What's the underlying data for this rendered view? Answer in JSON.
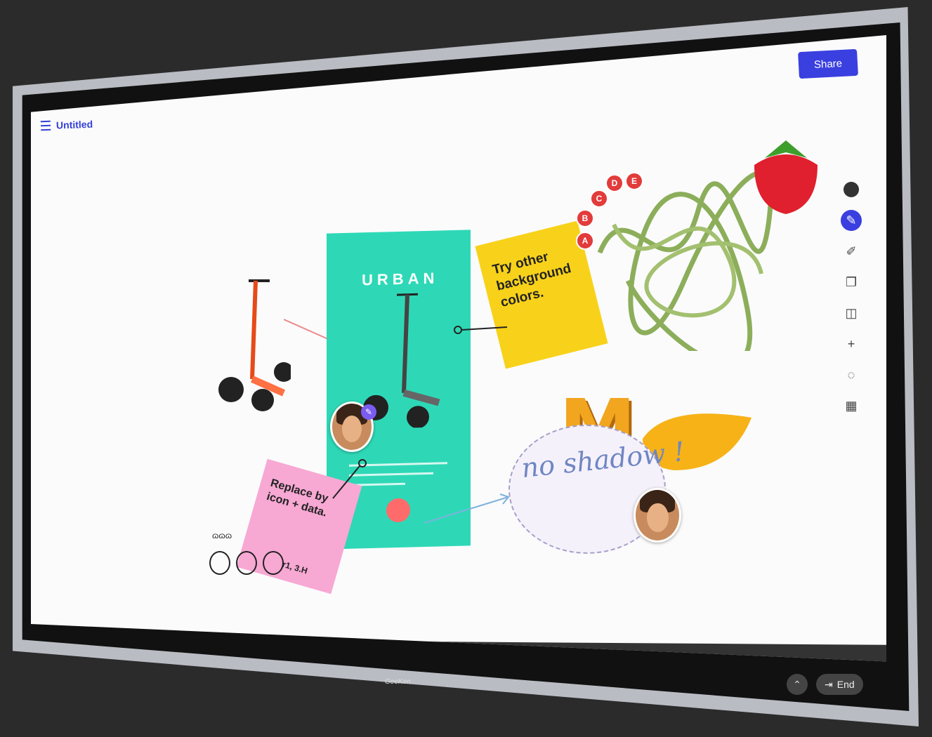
{
  "header": {
    "doc_title": "Untitled",
    "share_label": "Share"
  },
  "toolbar": {
    "tools": [
      "color-dot",
      "pen",
      "highlighter",
      "copy",
      "shape",
      "add",
      "lasso",
      "grid"
    ]
  },
  "canvas": {
    "yellow_note": "Try other background colors.",
    "pink_note": "Replace by icon + data.",
    "pink_note_value": "r1, 3.H",
    "bubble_text": "no shadow !",
    "maze_labels": [
      "A",
      "B",
      "C",
      "D",
      "E"
    ],
    "mango_letter": "M",
    "scribble_label": "ɷɷɷ"
  },
  "footer": {
    "end_label": "End",
    "brand": "GeeKen"
  },
  "colors": {
    "accent": "#3a3fe0",
    "phone": "#2ed8b6",
    "sticky_yellow": "#f8d21a",
    "sticky_pink": "#f7a8d3"
  }
}
